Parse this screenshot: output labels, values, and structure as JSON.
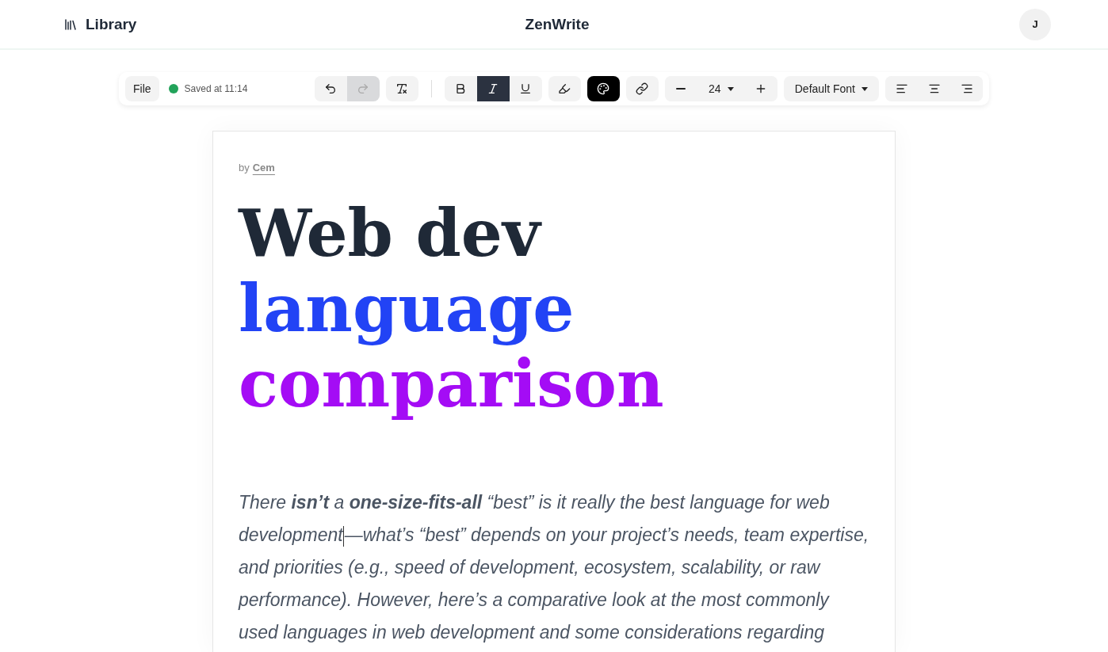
{
  "header": {
    "library_label": "Library",
    "app_title": "ZenWrite",
    "avatar_initial": "J"
  },
  "toolbar": {
    "file_label": "File",
    "save_status": {
      "text": "Saved at 11:14",
      "color": "#22a35a"
    },
    "tools": [
      {
        "kind": "undo",
        "disabled": false,
        "selected": false
      },
      {
        "kind": "redo",
        "disabled": true,
        "selected": false
      },
      {
        "kind": "clear-format",
        "disabled": false,
        "selected": false
      },
      {
        "kind": "divider"
      },
      {
        "kind": "bold",
        "disabled": false,
        "selected": false
      },
      {
        "kind": "italic",
        "disabled": false,
        "selected": true
      },
      {
        "kind": "underline",
        "disabled": false,
        "selected": false
      },
      {
        "kind": "highlight",
        "disabled": false,
        "selected": false
      },
      {
        "kind": "color",
        "disabled": false,
        "selected": true
      },
      {
        "kind": "link",
        "disabled": false,
        "selected": false
      }
    ],
    "font_size": "24",
    "font_family": "Default Font",
    "alignment": [
      {
        "kind": "left",
        "selected": false
      },
      {
        "kind": "center",
        "selected": false
      },
      {
        "kind": "right",
        "selected": false
      }
    ]
  },
  "document": {
    "byline_prefix": "by",
    "author": "Cem",
    "title_lines": [
      {
        "text": "Web dev",
        "color": "#1f2937"
      },
      {
        "text": "language",
        "color": "#2243f5"
      },
      {
        "text": "comparison",
        "color": "#a40cf5"
      }
    ],
    "body": [
      "There **isn’t** a **one-size-fits-all** “best” is it really the best language for web development",
      "—what’s “best” depends on your project’s needs, team expertise, and priorities (e.g., speed of development, ecosystem, scalability, or raw performance). However, here’s a comparative look at the most commonly used languages in web development and some considerations regarding"
    ]
  }
}
